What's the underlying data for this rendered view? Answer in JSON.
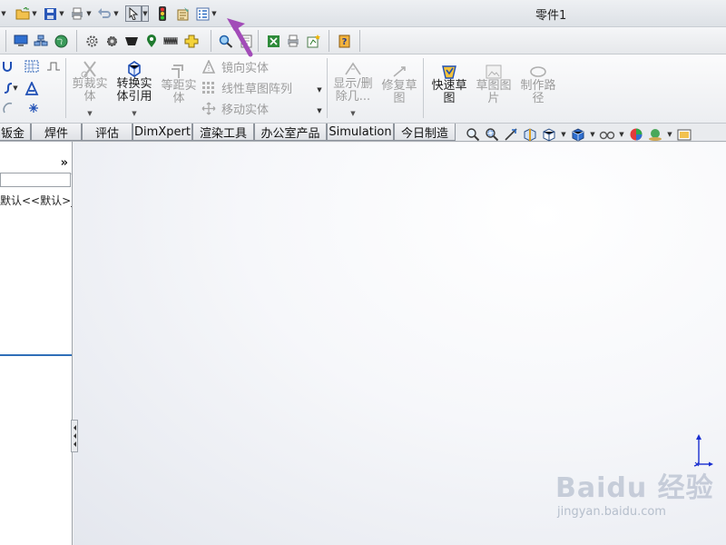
{
  "window": {
    "document_title": "零件1"
  },
  "ribbon": {
    "trim_label": "剪裁实体",
    "convert_label": "转换实体引用",
    "offset_label": "等距实体",
    "mirror_label": "镜向实体",
    "linear_pattern_label": "线性草图阵列",
    "move_label": "移动实体",
    "show_delete_label": "显示/删除几...",
    "repair_label": "修复草图",
    "quick_snaps_label": "快速草图",
    "sketch_picture_label": "草图图片",
    "path_label": "制作路径"
  },
  "tabs": [
    {
      "label": "钣金"
    },
    {
      "label": "焊件"
    },
    {
      "label": "评估"
    },
    {
      "label": "DimXpert"
    },
    {
      "label": "渲染工具"
    },
    {
      "label": "办公室产品"
    },
    {
      "label": "Simulation"
    },
    {
      "label": "今日制造"
    }
  ],
  "feature_manager": {
    "expand_glyph": "»",
    "config_text": "默认<<默认>_显示状态"
  },
  "watermark": {
    "brand": "Baidu 经验",
    "url": "jingyan.baidu.com"
  },
  "colors": {
    "annotation_arrow": "#a24bb8",
    "tree_highlight": "#2f6fb8",
    "triad_axis": "#1a2fd0"
  }
}
